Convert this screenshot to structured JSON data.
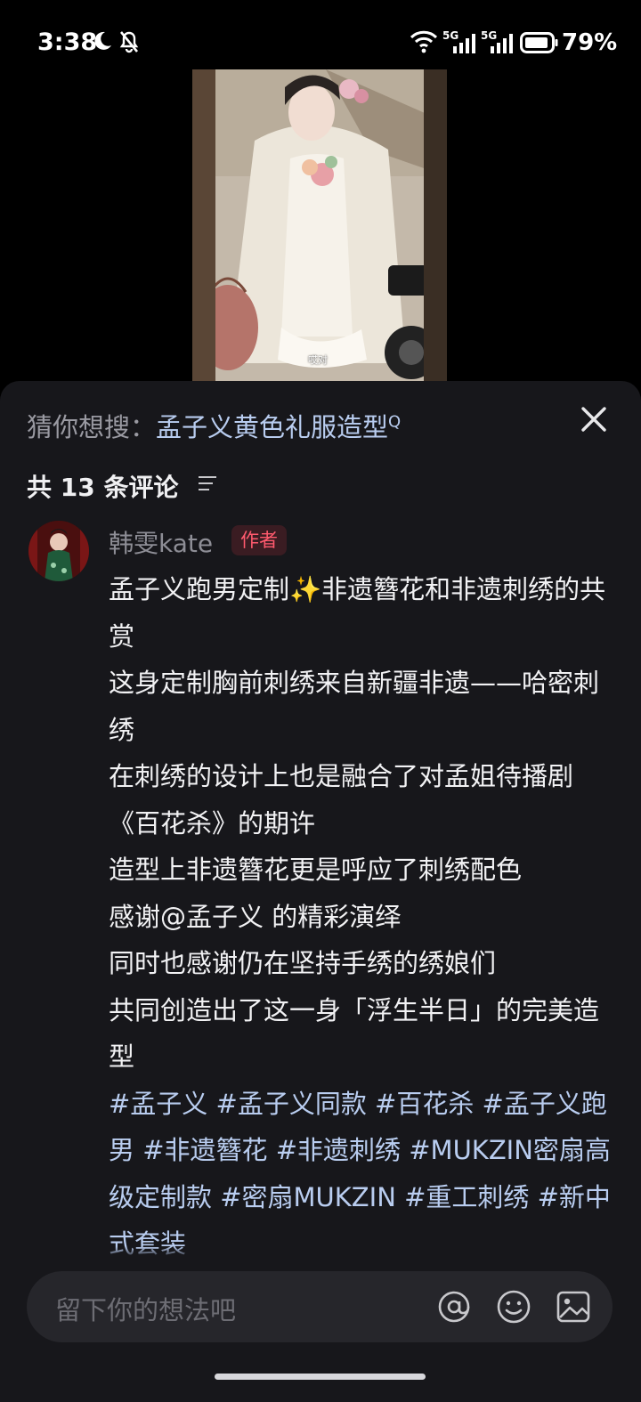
{
  "status_bar": {
    "time": "3:38",
    "battery": "79%",
    "signal_labels": [
      "5G",
      "5G"
    ],
    "icons": [
      "moon-icon",
      "bell-muted-icon",
      "wifi-icon",
      "signal-icon",
      "signal-icon",
      "battery-icon"
    ]
  },
  "video": {
    "subtitle": "哎对"
  },
  "suggest": {
    "prefix": "猜你想搜：",
    "keyword": "孟子义黄色礼服造型",
    "search_glyph": "Q"
  },
  "comments": {
    "count_label": "共 13 条评论",
    "item": {
      "author": "韩雯kate",
      "tag": "作者",
      "lines": [
        "孟子义跑男定制✨非遗簪花和非遗刺绣的共赏",
        "这身定制胸前刺绣来自新疆非遗——哈密刺绣",
        "在刺绣的设计上也是融合了对孟姐待播剧《百花杀》的期许",
        "造型上非遗簪花更是呼应了刺绣配色",
        "感谢@孟子义 的精彩演绎",
        "同时也感谢仍在坚持手绣的绣娘们",
        "共同创造出了这一身「浮生半日」的完美造型"
      ],
      "hashtags": "#孟子义 #孟子义同款 #百花杀 #孟子义跑男 #非遗簪花 #非遗刺绣 #MUKZIN密扇高级定制款 #密扇MUKZIN #重工刺绣 #新中式套装"
    }
  },
  "input": {
    "placeholder": "留下你的想法吧"
  },
  "colors": {
    "sheet_bg": "#17171b",
    "link_blue": "#b9cdf0",
    "author_tag_red": "#ff5a6e"
  }
}
